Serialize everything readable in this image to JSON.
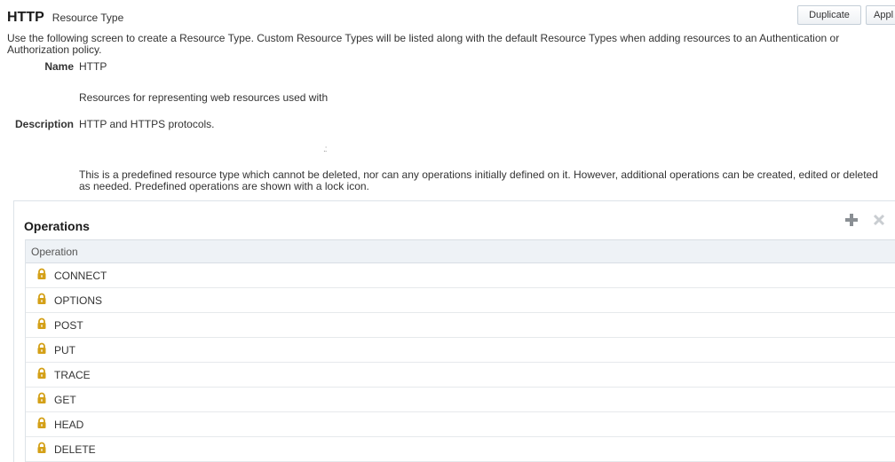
{
  "header": {
    "title": "HTTP",
    "subtitle": "Resource Type",
    "duplicate_label": "Duplicate",
    "apply_label": "Appl"
  },
  "intro": "Use the following screen to create a Resource Type. Custom Resource Types will be listed along with the default Resource Types when adding resources to an Authentication or Authorization policy.",
  "form": {
    "name_label": "Name",
    "name_value": "HTTP",
    "description_label": "Description",
    "description_line1": "Resources for representing web resources used with",
    "description_line2": "HTTP and HTTPS protocols."
  },
  "note": "This is a predefined resource type which cannot be deleted, nor can any operations initially defined on it. However, additional operations can be created, edited or deleted as needed. Predefined operations are shown with a lock icon.",
  "operations": {
    "title": "Operations",
    "add_icon": "plus-icon",
    "delete_icon": "x-icon",
    "column_header": "Operation",
    "rows": [
      {
        "label": "CONNECT",
        "icon": "lock-icon"
      },
      {
        "label": "OPTIONS",
        "icon": "lock-icon"
      },
      {
        "label": "POST",
        "icon": "lock-icon"
      },
      {
        "label": "PUT",
        "icon": "lock-icon"
      },
      {
        "label": "TRACE",
        "icon": "lock-icon"
      },
      {
        "label": "GET",
        "icon": "lock-icon"
      },
      {
        "label": "HEAD",
        "icon": "lock-icon"
      },
      {
        "label": "DELETE",
        "icon": "lock-icon"
      }
    ]
  },
  "colors": {
    "lock": "#d4a017",
    "header_bg": "#eef2f6",
    "icon_grey": "#8a8f94"
  }
}
